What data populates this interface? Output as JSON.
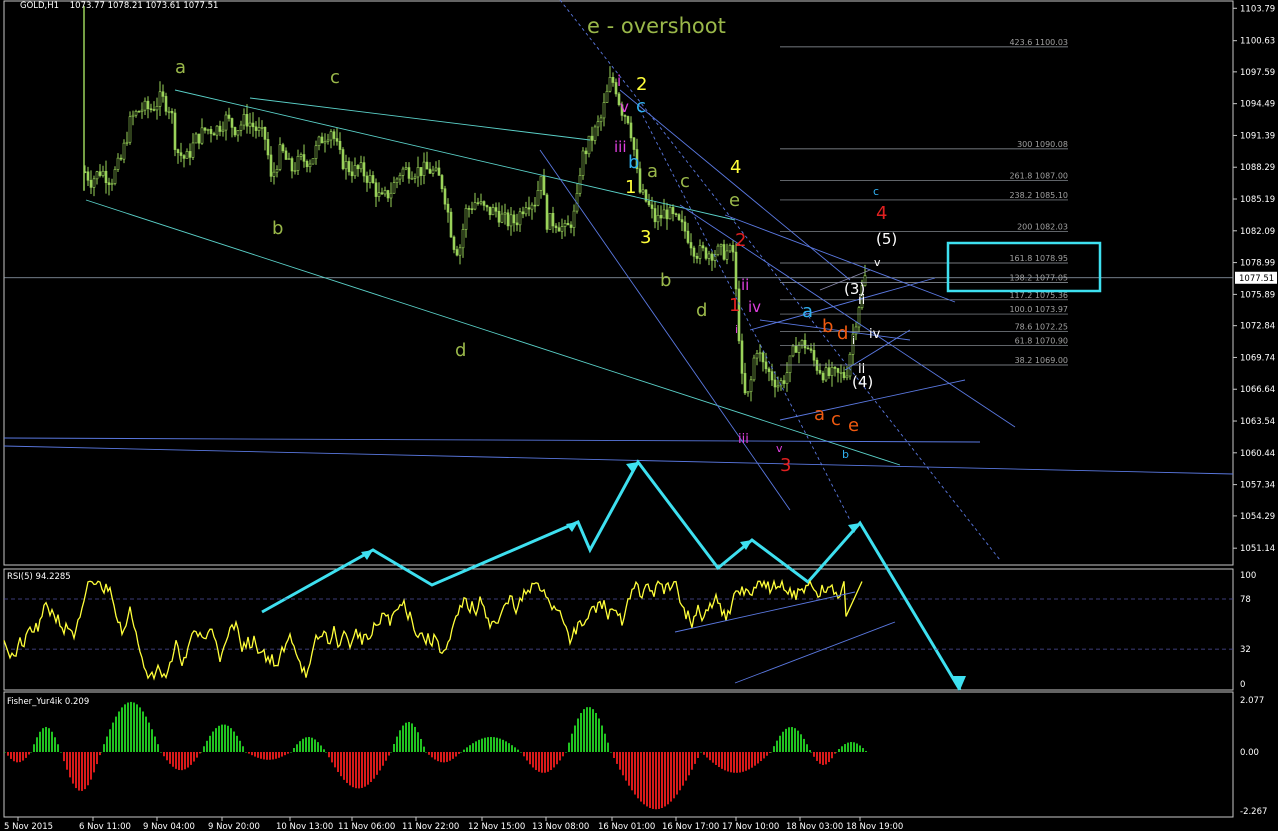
{
  "header": {
    "symbol_label": "GOLD,H1",
    "ohlc": "1073.77 1078.21 1073.61 1077.51",
    "rsi_label": "RSI(5) 94.2285",
    "fisher_label": "Fisher_Yur4ik 0.209",
    "current_price": "1077.51"
  },
  "chart_title_annotation": "e - overshoot",
  "colors": {
    "background": "#000000",
    "grid": "#1a1a1a",
    "candle": "#9ad35a",
    "channel": "#5a78e0",
    "cyan": "#3ee0f0",
    "rsi": "#ffff3a",
    "fisher_pos": "#21c321",
    "fisher_neg": "#d91a1a",
    "fib": "#9aa0a8"
  },
  "chart_data": [
    {
      "type": "candlestick",
      "symbol": "GOLD",
      "timeframe": "H1",
      "y_ticks": [
        "1103.79",
        "1100.63",
        "1097.59",
        "1094.49",
        "1091.39",
        "1088.29",
        "1085.19",
        "1082.09",
        "1078.99",
        "1075.89",
        "1072.84",
        "1069.74",
        "1066.64",
        "1063.54",
        "1060.44",
        "1057.34",
        "1054.29",
        "1051.14"
      ],
      "ylim": [
        1049.5,
        1104.5
      ],
      "x_ticks": [
        "5 Nov 2015",
        "6 Nov 11:00",
        "9 Nov 04:00",
        "9 Nov 20:00",
        "10 Nov 13:00",
        "11 Nov 06:00",
        "11 Nov 22:00",
        "12 Nov 15:00",
        "13 Nov 08:00",
        "16 Nov 01:00",
        "16 Nov 17:00",
        "17 Nov 10:00",
        "18 Nov 03:00",
        "18 Nov 19:00"
      ],
      "close_path": [
        [
          0,
          1104
        ],
        [
          80,
          1104
        ],
        [
          83,
          1088
        ],
        [
          90,
          1087
        ],
        [
          100,
          1088
        ],
        [
          110,
          1087
        ],
        [
          120,
          1089
        ],
        [
          130,
          1093
        ],
        [
          140,
          1094
        ],
        [
          150,
          1094
        ],
        [
          160,
          1095
        ],
        [
          170,
          1094
        ],
        [
          175,
          1090
        ],
        [
          185,
          1089
        ],
        [
          195,
          1091
        ],
        [
          205,
          1092
        ],
        [
          215,
          1092
        ],
        [
          225,
          1093
        ],
        [
          235,
          1092
        ],
        [
          245,
          1093
        ],
        [
          255,
          1092
        ],
        [
          265,
          1091
        ],
        [
          270,
          1087
        ],
        [
          280,
          1090
        ],
        [
          290,
          1088
        ],
        [
          300,
          1089
        ],
        [
          310,
          1089
        ],
        [
          320,
          1091
        ],
        [
          330,
          1092
        ],
        [
          340,
          1089
        ],
        [
          350,
          1088
        ],
        [
          360,
          1088
        ],
        [
          370,
          1087
        ],
        [
          380,
          1085
        ],
        [
          390,
          1086
        ],
        [
          400,
          1088
        ],
        [
          410,
          1088
        ],
        [
          420,
          1088
        ],
        [
          430,
          1088
        ],
        [
          440,
          1087
        ],
        [
          445,
          1085
        ],
        [
          452,
          1081
        ],
        [
          458,
          1080
        ],
        [
          465,
          1084
        ],
        [
          475,
          1085
        ],
        [
          485,
          1084
        ],
        [
          495,
          1084
        ],
        [
          505,
          1083
        ],
        [
          515,
          1083
        ],
        [
          525,
          1085
        ],
        [
          535,
          1085
        ],
        [
          540,
          1088
        ],
        [
          545,
          1083
        ],
        [
          555,
          1083
        ],
        [
          565,
          1082
        ],
        [
          575,
          1084
        ],
        [
          580,
          1089
        ],
        [
          590,
          1091
        ],
        [
          600,
          1093
        ],
        [
          610,
          1097
        ],
        [
          615,
          1096
        ],
        [
          620,
          1094
        ],
        [
          628,
          1093
        ],
        [
          633,
          1090
        ],
        [
          638,
          1086
        ],
        [
          645,
          1085
        ],
        [
          655,
          1083
        ],
        [
          665,
          1084
        ],
        [
          675,
          1083
        ],
        [
          685,
          1082
        ],
        [
          695,
          1080
        ],
        [
          705,
          1080
        ],
        [
          715,
          1080
        ],
        [
          725,
          1080
        ],
        [
          732,
          1080
        ],
        [
          738,
          1072
        ],
        [
          742,
          1066
        ],
        [
          748,
          1066
        ],
        [
          755,
          1071
        ],
        [
          762,
          1069
        ],
        [
          770,
          1068
        ],
        [
          778,
          1067
        ],
        [
          785,
          1068
        ],
        [
          795,
          1071
        ],
        [
          805,
          1071
        ],
        [
          815,
          1069
        ],
        [
          825,
          1068
        ],
        [
          835,
          1068
        ],
        [
          845,
          1068
        ],
        [
          852,
          1072
        ],
        [
          858,
          1075
        ],
        [
          863,
          1077.5
        ]
      ],
      "fib_levels": [
        {
          "label": "423.6 1100.03",
          "value": 1100.03
        },
        {
          "label": "300 1090.08",
          "value": 1090.08
        },
        {
          "label": "261.8 1087.00",
          "value": 1087.0
        },
        {
          "label": "238.2 1085.10",
          "value": 1085.1
        },
        {
          "label": "200 1082.03",
          "value": 1082.03
        },
        {
          "label": "161.8 1078.95",
          "value": 1078.95
        },
        {
          "label": "138.2 1077.05",
          "value": 1077.05
        },
        {
          "label": "117.2 1075.36",
          "value": 1075.36
        },
        {
          "label": "100.0 1073.97",
          "value": 1073.97
        },
        {
          "label": "78.6 1072.25",
          "value": 1072.25
        },
        {
          "label": "61.8 1070.90",
          "value": 1070.9
        },
        {
          "label": "38.2 1069.00",
          "value": 1069.0
        }
      ],
      "annotation_text": "e - overshoot"
    },
    {
      "type": "line",
      "name": "RSI(5)",
      "value": 94.2285,
      "y_ticks": [
        "100",
        "78",
        "32",
        "0"
      ],
      "ylim": [
        0,
        100
      ],
      "levels": [
        78,
        32
      ]
    },
    {
      "type": "bar",
      "name": "Fisher_Yur4ik",
      "value": 0.209,
      "y_ticks": [
        "2.077",
        "0.00",
        "-2.267"
      ],
      "ylim": [
        -2.267,
        2.077
      ]
    }
  ],
  "wave_labels": [
    {
      "t": "a",
      "c": "#9ab84a"
    },
    {
      "t": "c",
      "c": "#9ab84a"
    },
    {
      "t": "b",
      "c": "#9ab84a"
    },
    {
      "t": "d",
      "c": "#9ab84a"
    },
    {
      "t": "e - overshoot",
      "c": "#9ab84a"
    },
    {
      "t": "2",
      "c": "#ffff3a"
    },
    {
      "t": "1",
      "c": "#ffff3a"
    },
    {
      "t": "3",
      "c": "#ffff3a"
    },
    {
      "t": "4",
      "c": "#ffff3a"
    },
    {
      "t": "i",
      "c": "#e040e0"
    },
    {
      "t": "v",
      "c": "#e040e0"
    },
    {
      "t": "iii",
      "c": "#e040e0"
    },
    {
      "t": "ii",
      "c": "#e040e0"
    },
    {
      "t": "iv",
      "c": "#e040e0"
    },
    {
      "t": "c",
      "c": "#30b0f0"
    },
    {
      "t": "b",
      "c": "#30b0f0"
    },
    {
      "t": "a",
      "c": "#30b0f0"
    },
    {
      "t": "a",
      "c": "#9ab84a"
    },
    {
      "t": "c",
      "c": "#9ab84a"
    },
    {
      "t": "b",
      "c": "#9ab84a"
    },
    {
      "t": "d",
      "c": "#9ab84a"
    },
    {
      "t": "e",
      "c": "#9ab84a"
    },
    {
      "t": "1",
      "c": "#e02020"
    },
    {
      "t": "2",
      "c": "#e02020"
    },
    {
      "t": "3",
      "c": "#e02020"
    },
    {
      "t": "4",
      "c": "#e02020"
    },
    {
      "t": "(3)",
      "c": "#ffffff"
    },
    {
      "t": "(4)",
      "c": "#ffffff"
    },
    {
      "t": "(5)",
      "c": "#ffffff"
    },
    {
      "t": "b",
      "c": "#f05a10"
    },
    {
      "t": "d",
      "c": "#f05a10"
    },
    {
      "t": "a",
      "c": "#f05a10"
    },
    {
      "t": "c",
      "c": "#f05a10"
    },
    {
      "t": "e",
      "c": "#f05a10"
    }
  ]
}
